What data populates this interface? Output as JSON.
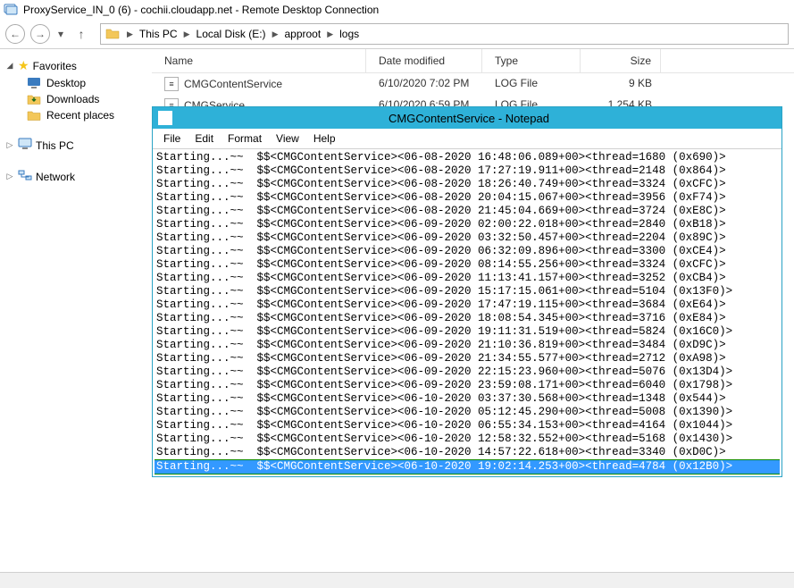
{
  "rdc_title": "ProxyService_IN_0 (6) - cochii.cloudapp.net - Remote Desktop Connection",
  "breadcrumb": {
    "root": "This PC",
    "a": "Local Disk (E:)",
    "b": "approot",
    "c": "logs"
  },
  "sidebar": {
    "favorites": "Favorites",
    "desktop": "Desktop",
    "downloads": "Downloads",
    "recent": "Recent places",
    "thispc": "This PC",
    "network": "Network"
  },
  "cols": {
    "name": "Name",
    "date": "Date modified",
    "type": "Type",
    "size": "Size"
  },
  "files": [
    {
      "name": "CMGContentService",
      "date": "6/10/2020 7:02 PM",
      "type": "LOG File",
      "size": "9 KB"
    },
    {
      "name": "CMGService",
      "date": "6/10/2020 6:59 PM",
      "type": "LOG File",
      "size": "1,254 KB"
    }
  ],
  "notepad": {
    "title": "CMGContentService - Notepad",
    "menu": {
      "file": "File",
      "edit": "Edit",
      "format": "Format",
      "view": "View",
      "help": "Help"
    },
    "lines": [
      "Starting...~~  $$<CMGContentService><06-08-2020 16:48:06.089+00><thread=1680 (0x690)>",
      "Starting...~~  $$<CMGContentService><06-08-2020 17:27:19.911+00><thread=2148 (0x864)>",
      "Starting...~~  $$<CMGContentService><06-08-2020 18:26:40.749+00><thread=3324 (0xCFC)>",
      "Starting...~~  $$<CMGContentService><06-08-2020 20:04:15.067+00><thread=3956 (0xF74)>",
      "Starting...~~  $$<CMGContentService><06-08-2020 21:45:04.669+00><thread=3724 (0xE8C)>",
      "Starting...~~  $$<CMGContentService><06-09-2020 02:00:22.018+00><thread=2840 (0xB18)>",
      "Starting...~~  $$<CMGContentService><06-09-2020 03:32:50.457+00><thread=2204 (0x89C)>",
      "Starting...~~  $$<CMGContentService><06-09-2020 06:32:09.896+00><thread=3300 (0xCE4)>",
      "Starting...~~  $$<CMGContentService><06-09-2020 08:14:55.256+00><thread=3324 (0xCFC)>",
      "Starting...~~  $$<CMGContentService><06-09-2020 11:13:41.157+00><thread=3252 (0xCB4)>",
      "Starting...~~  $$<CMGContentService><06-09-2020 15:17:15.061+00><thread=5104 (0x13F0)>",
      "Starting...~~  $$<CMGContentService><06-09-2020 17:47:19.115+00><thread=3684 (0xE64)>",
      "Starting...~~  $$<CMGContentService><06-09-2020 18:08:54.345+00><thread=3716 (0xE84)>",
      "Starting...~~  $$<CMGContentService><06-09-2020 19:11:31.519+00><thread=5824 (0x16C0)>",
      "Starting...~~  $$<CMGContentService><06-09-2020 21:10:36.819+00><thread=3484 (0xD9C)>",
      "Starting...~~  $$<CMGContentService><06-09-2020 21:34:55.577+00><thread=2712 (0xA98)>",
      "Starting...~~  $$<CMGContentService><06-09-2020 22:15:23.960+00><thread=5076 (0x13D4)>",
      "Starting...~~  $$<CMGContentService><06-09-2020 23:59:08.171+00><thread=6040 (0x1798)>",
      "Starting...~~  $$<CMGContentService><06-10-2020 03:37:30.568+00><thread=1348 (0x544)>",
      "Starting...~~  $$<CMGContentService><06-10-2020 05:12:45.290+00><thread=5008 (0x1390)>",
      "Starting...~~  $$<CMGContentService><06-10-2020 06:55:34.153+00><thread=4164 (0x1044)>",
      "Starting...~~  $$<CMGContentService><06-10-2020 12:58:32.552+00><thread=5168 (0x1430)>",
      "Starting...~~  $$<CMGContentService><06-10-2020 14:57:22.618+00><thread=3340 (0xD0C)>",
      "Starting...~~  $$<CMGContentService><06-10-2020 19:02:14.253+00><thread=4784 (0x12B0)>"
    ],
    "selected_index": 23
  }
}
